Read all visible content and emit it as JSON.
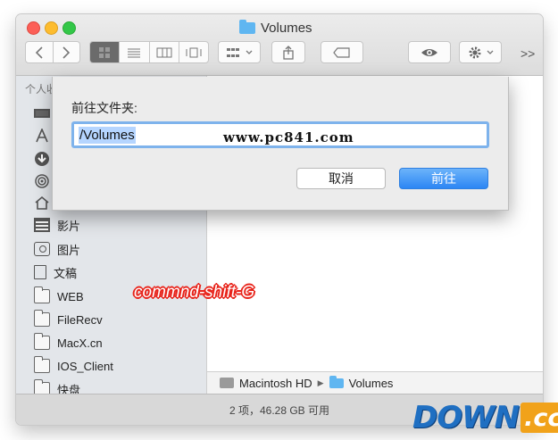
{
  "window": {
    "title": "Volumes"
  },
  "sidebar": {
    "heading": "个人收",
    "items": [
      {
        "label": "影片",
        "icon": "film-icon"
      },
      {
        "label": "图片",
        "icon": "camera-icon"
      },
      {
        "label": "文稿",
        "icon": "document-icon"
      },
      {
        "label": "WEB",
        "icon": "folder-icon"
      },
      {
        "label": "FileRecv",
        "icon": "folder-icon"
      },
      {
        "label": "MacX.cn",
        "icon": "folder-icon"
      },
      {
        "label": "IOS_Client",
        "icon": "folder-icon"
      },
      {
        "label": "快盘",
        "icon": "folder-icon"
      }
    ]
  },
  "dialog": {
    "label": "前往文件夹:",
    "input_value": "/Volumes",
    "cancel_label": "取消",
    "go_label": "前往"
  },
  "watermark": "www.pc841.com",
  "annotation": "commnd-shift-G",
  "pathbar": {
    "drive": "Macintosh HD",
    "folder": "Volumes"
  },
  "status": "2 项，46.28 GB 可用",
  "logo": {
    "main": "DOWN",
    "suffix": ".cc"
  },
  "colors": {
    "accent": "#2c86f4",
    "folder": "#5fb6f1",
    "annotation": "#e8241b"
  }
}
